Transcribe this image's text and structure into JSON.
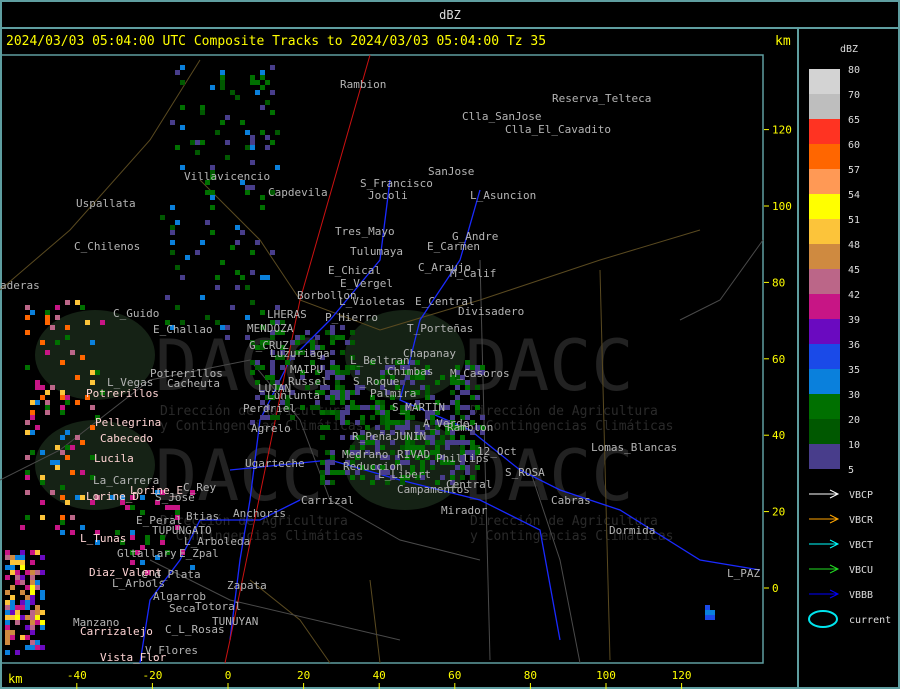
{
  "window": {
    "title": "dBZ"
  },
  "header": {
    "title": "2024/03/03 05:04:00 UTC Composite Tracks to 2024/03/03 05:04:00 Tz 35",
    "unit": "km"
  },
  "axes": {
    "x_unit": "km",
    "x_ticks": [
      "-40",
      "-20",
      "0",
      "20",
      "40",
      "60",
      "80",
      "100",
      "120"
    ],
    "y_ticks": [
      "120",
      "100",
      "80",
      "60",
      "40",
      "20",
      "0"
    ]
  },
  "legend": {
    "title": "dBZ",
    "bands": [
      {
        "label": "80",
        "color": "#d3d3d3"
      },
      {
        "label": "70",
        "color": "#bebebe"
      },
      {
        "label": "65",
        "color": "#ff3322"
      },
      {
        "label": "60",
        "color": "#ff6600"
      },
      {
        "label": "57",
        "color": "#ff9955"
      },
      {
        "label": "54",
        "color": "#ffff00"
      },
      {
        "label": "51",
        "color": "#fcc43a"
      },
      {
        "label": "48",
        "color": "#cf8a40"
      },
      {
        "label": "45",
        "color": "#bb6688"
      },
      {
        "label": "42",
        "color": "#c71585"
      },
      {
        "label": "39",
        "color": "#6a0ac0"
      },
      {
        "label": "36",
        "color": "#1a4ae8"
      },
      {
        "label": "35",
        "color": "#0a80dc"
      },
      {
        "label": "30",
        "color": "#007000"
      },
      {
        "label": "20",
        "color": "#005800"
      },
      {
        "label": "10",
        "color": "#483d8b"
      }
    ],
    "bottom_label": "5",
    "tracks": [
      {
        "label": "VBCP",
        "color": "#ffffff"
      },
      {
        "label": "VBCR",
        "color": "#ffa500"
      },
      {
        "label": "VBCT",
        "color": "#00ffff"
      },
      {
        "label": "VBCU",
        "color": "#22dd22"
      },
      {
        "label": "VBBB",
        "color": "#0000ff"
      }
    ],
    "current": {
      "label": "current",
      "color": "#00e5ee"
    }
  },
  "map": {
    "watermark": "DACC",
    "watermark_text": [
      "Dirección de Agricultura",
      "y Contingencias Climáticas"
    ],
    "places": [
      "Rambion",
      "Reserva_Telteca",
      "Clla_SanJose",
      "Clla_El_Cavadito",
      "Villavicencio",
      "Capdevila",
      "S_Francisco",
      "Jocoli",
      "SanJose",
      "L_Asuncion",
      "Uspallata",
      "Tres_Mayo",
      "G_Andre",
      "C_Chilenos",
      "E_Carmen",
      "Tulumaya",
      "E_Chical",
      "C_Araujo",
      "M_Calif",
      "E_Vergel",
      "Borbollon",
      "L_Violetas",
      "E_Central",
      "aderas",
      "Divisadero",
      "C_Guido",
      "P_Hierro",
      "LHERAS",
      "E_Challao",
      "MENDOZA",
      "T_Porteñas",
      "G_CRUZ",
      "Luzuriaga",
      "Chapanay",
      "L_Beltran",
      "MAIPU",
      "Chimbas",
      "M_Casoros",
      "Potrerillos",
      "L_Vegas",
      "Cacheuta",
      "Russel",
      "S_Roque",
      "LUJAN",
      "Lunlunta",
      "Palmira",
      "Perdriel",
      "S_MARTIN",
      "A_Verde",
      "Ramblon",
      "Agrelo",
      "R_Peña",
      "JUNIN",
      "Lomas_Blancas",
      "12_Oct",
      "Medrano",
      "RIVAD",
      "Phillips",
      "Ugarteche",
      "Reduccion",
      "S_ROSA",
      "L_Libert",
      "Central",
      "La_Carrera",
      "Campamentos",
      "C_Rey",
      "Carrizal",
      "S_Jose",
      "Cabras",
      "Anchoris",
      "Mirador",
      "E_Peral",
      "Btias",
      "TUPUNGATO",
      "Dormida",
      "L_Arboleda",
      "Gltallary",
      "E_Zpal",
      "C_d_Plata",
      "L_PAZ",
      "L_Arbols",
      "Zapata",
      "Algarrob",
      "Seca",
      "Totoral",
      "Manzano",
      "TUNUYAN",
      "C_L_Rosas",
      "V_Flores"
    ],
    "stations": [
      "Potrerillos",
      "Pellegrina",
      "Cabecedo",
      "Lucila",
      "Lorine_E",
      "Lorine_D",
      "L_Tunas",
      "Diaz_Valent",
      "Carrizalejo",
      "Vista_Flor"
    ]
  }
}
